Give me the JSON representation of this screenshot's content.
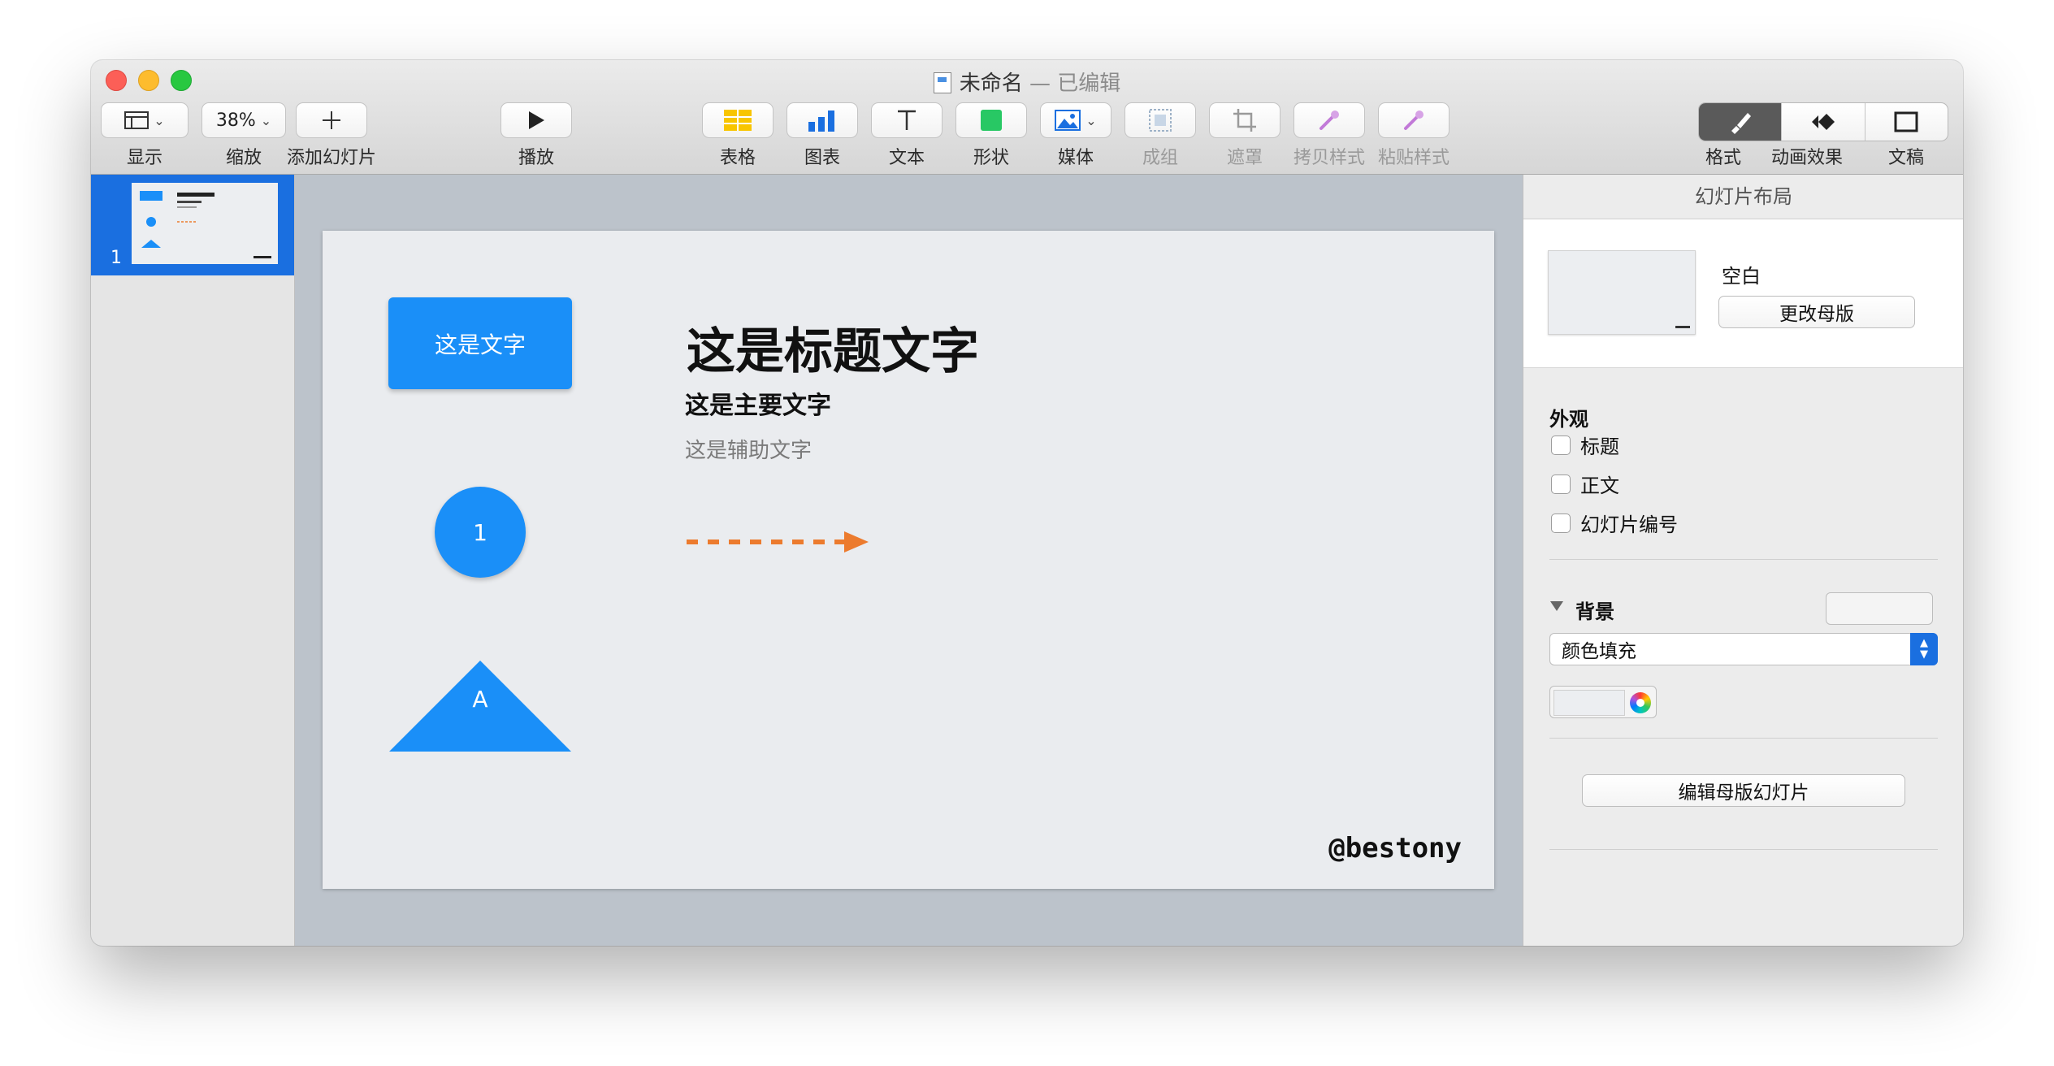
{
  "window": {
    "title": "未命名",
    "title_status": "— 已编辑"
  },
  "toolbar": {
    "view_label": "显示",
    "zoom_value": "38%",
    "zoom_label": "缩放",
    "add_slide_label": "添加幻灯片",
    "play_label": "播放",
    "table_label": "表格",
    "chart_label": "图表",
    "text_label": "文本",
    "shape_label": "形状",
    "media_label": "媒体",
    "group_label": "成组",
    "mask_label": "遮罩",
    "copy_style_label": "拷贝样式",
    "paste_style_label": "粘贴样式",
    "format_label": "格式",
    "animate_label": "动画效果",
    "document_label": "文稿"
  },
  "navigator": {
    "slides": [
      {
        "number": "1",
        "selected": true
      }
    ]
  },
  "slide": {
    "box_text": "这是文字",
    "circle_text": "1",
    "triangle_text": "A",
    "title": "这是标题文字",
    "main_text": "这是主要文字",
    "aux_text": "这是辅助文字",
    "handle": "@bestony",
    "shape_color": "#1a8ff8",
    "arrow_color": "#ec7b2e"
  },
  "inspector": {
    "header": "幻灯片布局",
    "master_name": "空白",
    "change_master_button": "更改母版",
    "appearance_label": "外观",
    "checkboxes": [
      {
        "label": "标题",
        "checked": false
      },
      {
        "label": "正文",
        "checked": false
      },
      {
        "label": "幻灯片编号",
        "checked": false
      }
    ],
    "background_label": "背景",
    "fill_select_value": "颜色填充",
    "edit_master_button": "编辑母版幻灯片"
  },
  "colors": {
    "accent": "#1a6fe0",
    "slide_background": "#eaecef"
  }
}
